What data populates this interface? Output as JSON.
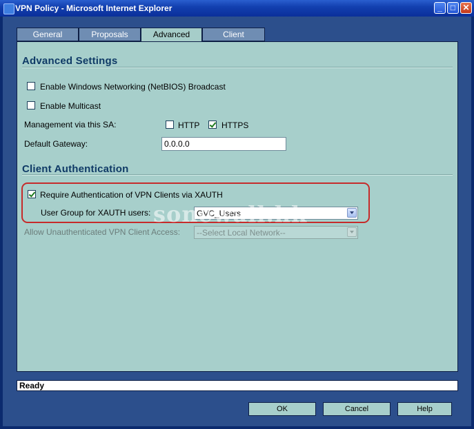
{
  "window": {
    "title": "VPN Policy - Microsoft Internet Explorer"
  },
  "tabs": [
    {
      "label": "General"
    },
    {
      "label": "Proposals"
    },
    {
      "label": "Advanced",
      "active": true
    },
    {
      "label": "Client"
    }
  ],
  "advanced": {
    "heading": "Advanced Settings",
    "netbios_label": "Enable Windows Networking (NetBIOS) Broadcast",
    "netbios_checked": false,
    "multicast_label": "Enable Multicast",
    "multicast_checked": false,
    "management_label": "Management via this SA:",
    "http_label": "HTTP",
    "http_checked": false,
    "https_label": "HTTPS",
    "https_checked": true,
    "gateway_label": "Default Gateway:",
    "gateway_value": "0.0.0.0"
  },
  "client_auth": {
    "heading": "Client Authentication",
    "xauth_label": "Require Authentication of VPN Clients via XAUTH",
    "xauth_checked": true,
    "usergroup_label": "User Group for XAUTH users:",
    "usergroup_value": "GVC_Users",
    "unauth_label": "Allow Unauthenticated VPN Client Access:",
    "unauth_value": "--Select Local Network--"
  },
  "watermark": "sonewall.hk",
  "status": "Ready",
  "buttons": {
    "ok": "OK",
    "cancel": "Cancel",
    "help": "Help"
  },
  "colors": {
    "panel": "#a7cfcb",
    "titlebar": "#1340b0",
    "highlight_box": "#c62a2a"
  }
}
